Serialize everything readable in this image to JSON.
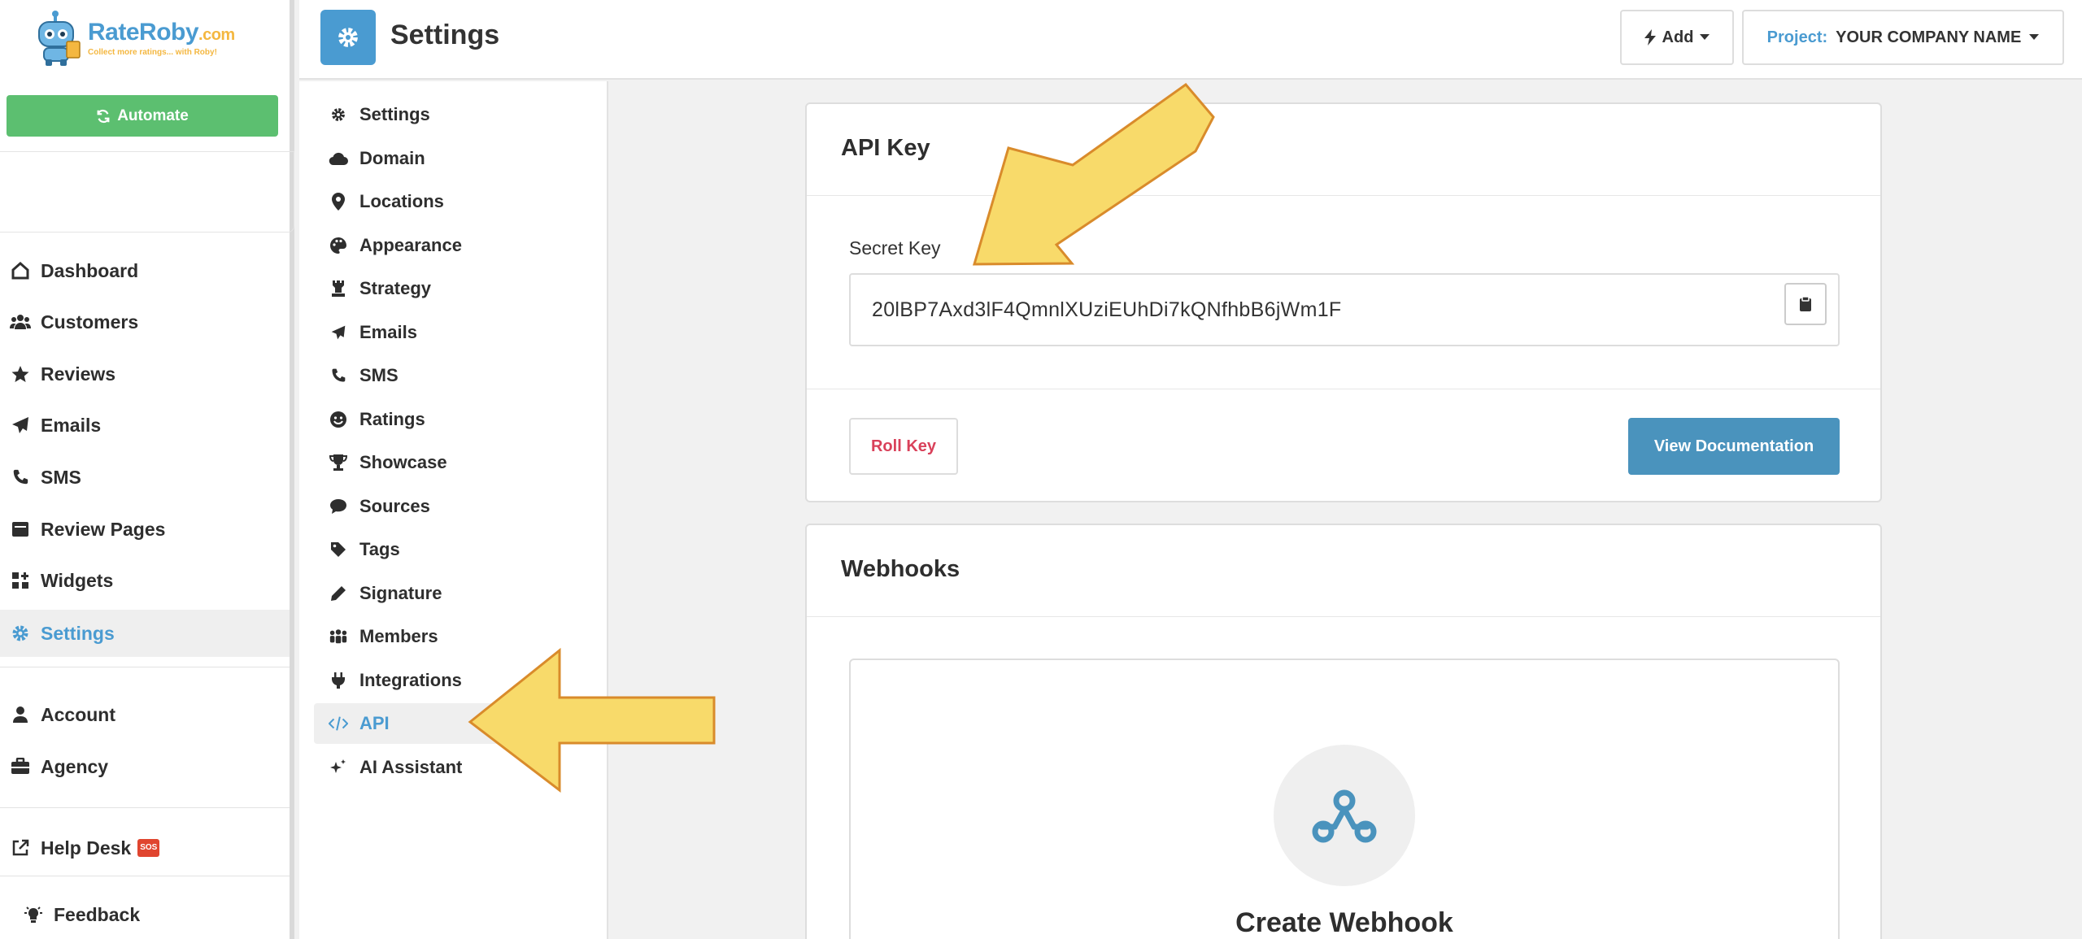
{
  "brand": {
    "name": "RateRoby",
    "suffix": ".com",
    "tagline": "Collect more ratings... with Roby!"
  },
  "sidebar": {
    "automate_label": "Automate",
    "items": [
      {
        "label": "Dashboard",
        "icon": "home-icon"
      },
      {
        "label": "Customers",
        "icon": "users-icon"
      },
      {
        "label": "Reviews",
        "icon": "star-icon"
      },
      {
        "label": "Emails",
        "icon": "paper-plane-icon"
      },
      {
        "label": "SMS",
        "icon": "phone-icon"
      },
      {
        "label": "Review Pages",
        "icon": "page-icon"
      },
      {
        "label": "Widgets",
        "icon": "widgets-icon"
      },
      {
        "label": "Settings",
        "icon": "gear-icon",
        "active": true
      },
      {
        "label": "Account",
        "icon": "user-icon"
      },
      {
        "label": "Agency",
        "icon": "briefcase-icon"
      },
      {
        "label": "Help Desk",
        "icon": "external-link-icon",
        "badge": "SOS"
      },
      {
        "label": "Feedback",
        "icon": "lightbulb-icon"
      }
    ]
  },
  "topbar": {
    "title": "Settings",
    "add_label": "Add",
    "project_label": "Project:",
    "project_value": "YOUR COMPANY NAME"
  },
  "subnav": {
    "items": [
      {
        "label": "Settings",
        "icon": "gear-icon"
      },
      {
        "label": "Domain",
        "icon": "cloud-icon"
      },
      {
        "label": "Locations",
        "icon": "map-pin-icon"
      },
      {
        "label": "Appearance",
        "icon": "palette-icon"
      },
      {
        "label": "Strategy",
        "icon": "chess-icon"
      },
      {
        "label": "Emails",
        "icon": "paper-plane-icon"
      },
      {
        "label": "SMS",
        "icon": "phone-icon"
      },
      {
        "label": "Ratings",
        "icon": "smile-icon"
      },
      {
        "label": "Showcase",
        "icon": "trophy-icon"
      },
      {
        "label": "Sources",
        "icon": "comment-icon"
      },
      {
        "label": "Tags",
        "icon": "tag-icon"
      },
      {
        "label": "Signature",
        "icon": "pen-icon"
      },
      {
        "label": "Members",
        "icon": "members-icon"
      },
      {
        "label": "Integrations",
        "icon": "plug-icon"
      },
      {
        "label": "API",
        "icon": "code-icon",
        "active": true
      },
      {
        "label": "AI Assistant",
        "icon": "sparkles-icon"
      }
    ]
  },
  "api_card": {
    "title": "API Key",
    "secret_label": "Secret Key",
    "secret_value": "20lBP7Axd3lF4QmnlXUziEUhDi7kQNfhbB6jWm1F",
    "roll_label": "Roll Key",
    "docs_label": "View Documentation"
  },
  "webhooks_card": {
    "title": "Webhooks",
    "create_label": "Create Webhook"
  },
  "colors": {
    "accent": "#4a9bd1",
    "automate": "#5cbf70",
    "danger": "#d9415a",
    "docs_button": "#4a93bd",
    "annotation_arrow": "#f8da6a",
    "annotation_stroke": "#d98b2b"
  }
}
